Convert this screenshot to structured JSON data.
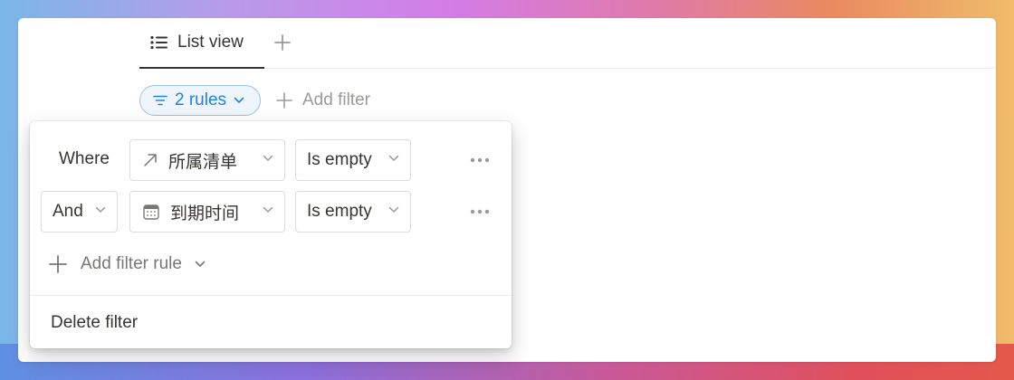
{
  "tabs": [
    {
      "label": "List view",
      "icon": "list-icon",
      "active": true
    }
  ],
  "add_tab_icon": "plus-icon",
  "filter_bar": {
    "rules_label": "2 rules",
    "add_filter_label": "Add filter"
  },
  "popover": {
    "rules": [
      {
        "connector": "Where",
        "property": "所属清单",
        "property_icon": "relation-arrow-icon",
        "condition": "Is empty"
      },
      {
        "connector": "And",
        "property": "到期时间",
        "property_icon": "calendar-icon",
        "condition": "Is empty"
      }
    ],
    "add_rule_label": "Add filter rule",
    "delete_label": "Delete filter"
  },
  "colors": {
    "accent": "#2383e2",
    "text": "#37352f",
    "muted": "#9b9a97"
  }
}
